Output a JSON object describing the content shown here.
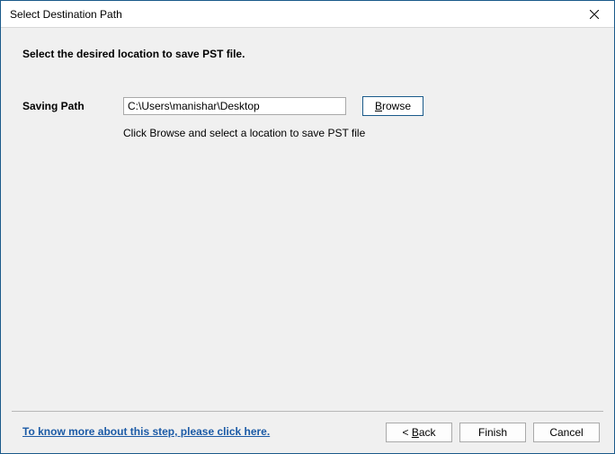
{
  "titlebar": {
    "title": "Select Destination Path"
  },
  "content": {
    "instruction": "Select the desired location to save PST file.",
    "saving_label": "Saving Path",
    "path_value": "C:\\Users\\manishar\\Desktop",
    "browse_prefix": "B",
    "browse_rest": "rowse",
    "hint": "Click Browse and select a location to save PST file"
  },
  "footer": {
    "help_link": "To know more about this step, please click here.",
    "back_prefix": "< ",
    "back_mn": "B",
    "back_rest": "ack",
    "finish_label": "Finish",
    "cancel_label": "Cancel"
  }
}
